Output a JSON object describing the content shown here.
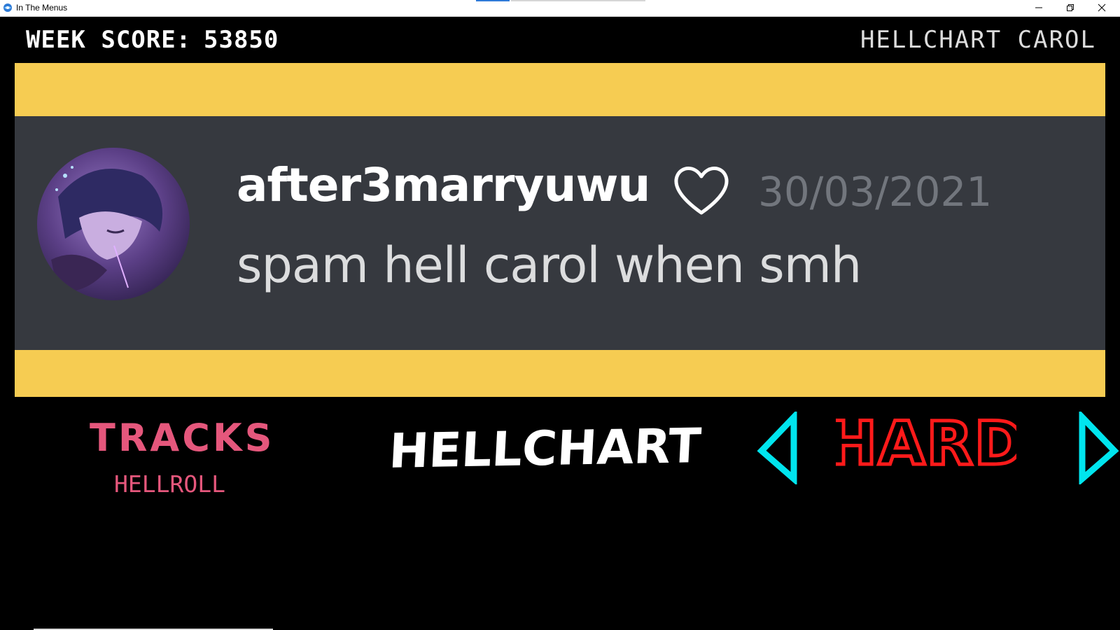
{
  "window": {
    "title": "In The Menus",
    "controls": {
      "minimize": "minimize-icon",
      "maximize": "restore-icon",
      "close": "close-icon"
    }
  },
  "hud": {
    "week_score_label": "WEEK SCORE:",
    "week_score_value": "53850",
    "week_name": "HELLCHART CAROL"
  },
  "banner": {
    "username": "after3marryuwu",
    "username_icon": "heart-outline-icon",
    "timestamp": "30/03/2021",
    "message": "spam hell carol when smh",
    "colors": {
      "banner": "#f6cc52",
      "card": "#36393f",
      "timestamp": "#72767d"
    }
  },
  "tracks": {
    "heading": "TRACKS",
    "items": [
      "HELLROLL"
    ],
    "color": "#e5577c"
  },
  "week_select": {
    "title": "HELLCHART",
    "difficulty": "HARD",
    "difficulty_color": "#ff1a1a",
    "arrow_color": "#00e5ee",
    "arrow_left_icon": "arrow-left-icon",
    "arrow_right_icon": "arrow-right-icon"
  }
}
